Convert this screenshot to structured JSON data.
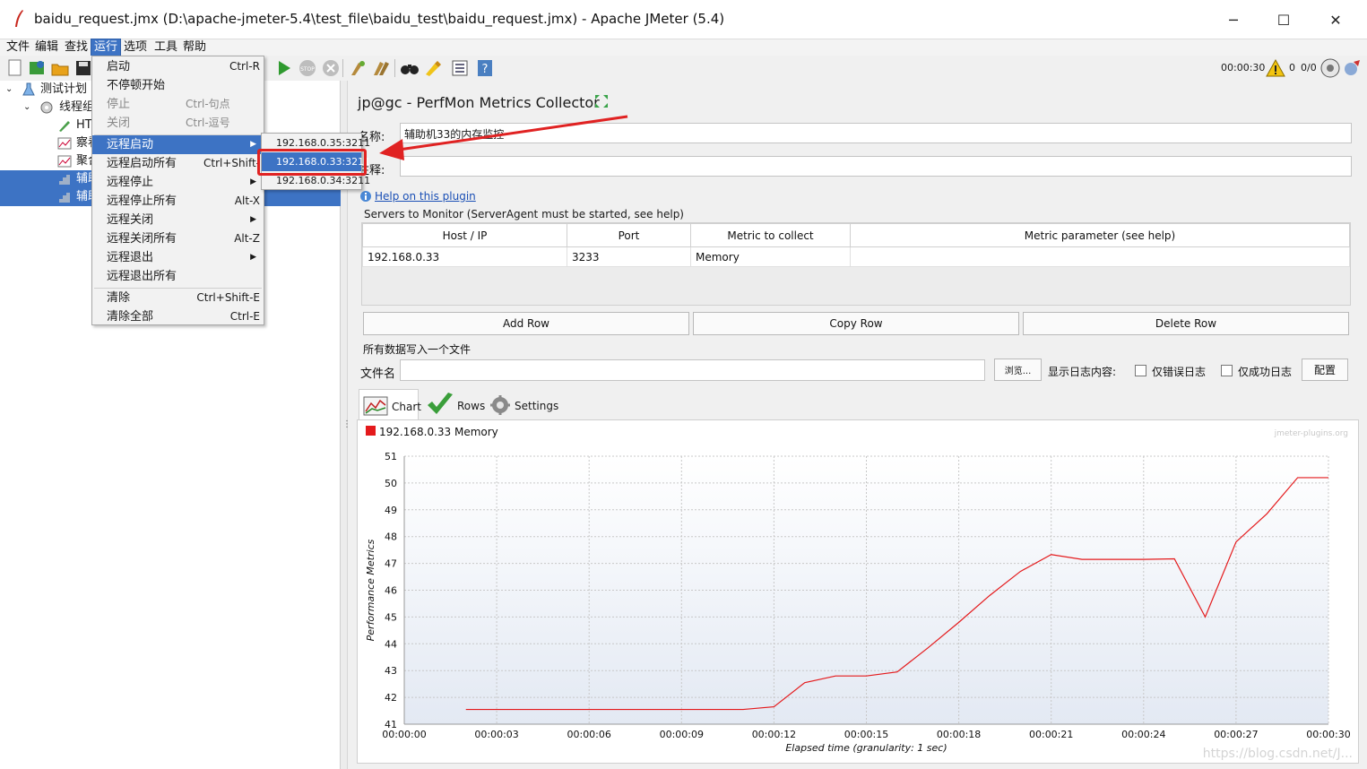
{
  "window": {
    "title": "baidu_request.jmx (D:\\apache-jmeter-5.4\\test_file\\baidu_test\\baidu_request.jmx) - Apache JMeter (5.4)",
    "minimize": "─",
    "maximize": "☐",
    "close": "✕"
  },
  "menubar": {
    "items": [
      "文件",
      "编辑",
      "查找",
      "运行",
      "选项",
      "工具",
      "帮助"
    ],
    "active": "运行"
  },
  "toolbar": {
    "elapsed": "00:00:30",
    "warnings": "0",
    "threads": "0/0"
  },
  "tree": {
    "items": [
      {
        "label": "测试计划"
      },
      {
        "label": "线程组"
      },
      {
        "label": "HT"
      },
      {
        "label": "察看"
      },
      {
        "label": "聚合"
      },
      {
        "label": "辅助"
      },
      {
        "label": "辅助"
      }
    ]
  },
  "run_menu": {
    "items": [
      {
        "label": "启动",
        "shortcut": "Ctrl-R"
      },
      {
        "label": "不停顿开始",
        "shortcut": ""
      },
      {
        "label": "停止",
        "shortcut": "Ctrl-句点"
      },
      {
        "label": "关闭",
        "shortcut": "Ctrl-逗号"
      },
      {
        "label": "远程启动",
        "shortcut": ""
      },
      {
        "label": "远程启动所有",
        "shortcut": "Ctrl+Shift-R"
      },
      {
        "label": "远程停止",
        "shortcut": ""
      },
      {
        "label": "远程停止所有",
        "shortcut": "Alt-X"
      },
      {
        "label": "远程关闭",
        "shortcut": ""
      },
      {
        "label": "远程关闭所有",
        "shortcut": "Alt-Z"
      },
      {
        "label": "远程退出",
        "shortcut": ""
      },
      {
        "label": "远程退出所有",
        "shortcut": ""
      },
      {
        "label": "清除",
        "shortcut": "Ctrl+Shift-E"
      },
      {
        "label": "清除全部",
        "shortcut": "Ctrl-E"
      }
    ],
    "submenu": [
      "192.168.0.35:3211",
      "192.168.0.33:3211",
      "192.168.0.34:3211"
    ]
  },
  "panel": {
    "title": "jp@gc - PerfMon Metrics Collector",
    "name_label": "名称:",
    "name_value": "辅助机33的内存监控",
    "comment_label": "注释:",
    "comment_value": "",
    "help_link": "Help on this plugin",
    "servers_label": "Servers to Monitor (ServerAgent must be started, see help)",
    "table": {
      "headers": [
        "Host / IP",
        "Port",
        "Metric to collect",
        "Metric parameter (see help)"
      ],
      "rows": [
        [
          "192.168.0.33",
          "3233",
          "Memory",
          ""
        ]
      ]
    },
    "add_row": "Add Row",
    "copy_row": "Copy Row",
    "delete_row": "Delete Row",
    "write_all_label": "所有数据写入一个文件",
    "filename_label": "文件名",
    "filename_value": "",
    "browse": "浏览...",
    "log_label": "显示日志内容:",
    "errors_only": "仅错误日志",
    "success_only": "仅成功日志",
    "configure": "配置",
    "tabs": [
      "Chart",
      "Rows",
      "Settings"
    ]
  },
  "chart_data": {
    "type": "line",
    "legend": [
      "192.168.0.33 Memory"
    ],
    "watermark": "jmeter-plugins.org",
    "site_watermark": "https://blog.csdn.net/J...",
    "xlabel": "Elapsed time (granularity: 1 sec)",
    "ylabel": "Performance Metrics",
    "xlim": [
      0,
      30
    ],
    "ylim": [
      41,
      51
    ],
    "x_ticks": [
      "00:00:00",
      "00:00:03",
      "00:00:06",
      "00:00:09",
      "00:00:12",
      "00:00:15",
      "00:00:18",
      "00:00:21",
      "00:00:24",
      "00:00:27",
      "00:00:30"
    ],
    "y_ticks": [
      "41",
      "42",
      "43",
      "44",
      "45",
      "46",
      "47",
      "48",
      "49",
      "50",
      "51"
    ],
    "series": [
      {
        "name": "192.168.0.33 Memory",
        "color": "#e41a1c",
        "x": [
          2,
          3,
          4,
          5,
          6,
          7,
          8,
          9,
          10,
          11,
          12,
          13,
          14,
          15,
          16,
          17,
          18,
          19,
          20,
          21,
          22,
          23,
          24,
          25,
          26,
          27,
          28,
          29,
          30
        ],
        "y": [
          41.55,
          41.55,
          41.55,
          41.55,
          41.55,
          41.55,
          41.55,
          41.55,
          41.55,
          41.55,
          41.65,
          42.55,
          42.8,
          42.8,
          42.95,
          43.85,
          44.8,
          45.8,
          46.7,
          47.33,
          47.15,
          47.15,
          47.15,
          47.17,
          45.0,
          47.8,
          48.85,
          50.2,
          50.2
        ]
      }
    ]
  }
}
